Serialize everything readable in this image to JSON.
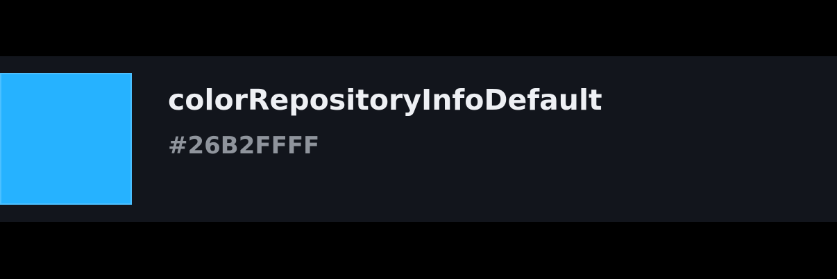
{
  "color_entry": {
    "name": "colorRepositoryInfoDefault",
    "hex": "#26B2FFFF",
    "swatch_color": "#26B2FF"
  },
  "colors": {
    "page_background": "#000000",
    "card_background": "#12151c",
    "name_text": "#eef0f4",
    "hex_text": "#8f949c"
  }
}
